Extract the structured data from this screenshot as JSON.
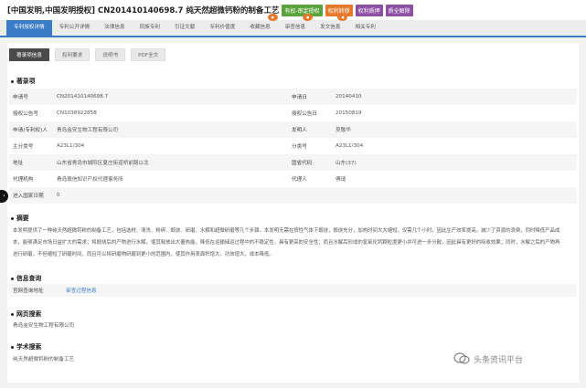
{
  "header": {
    "title": "[中国发明,中国发明授权] CN201410140698.7   纯天然超微钙粉的制备工艺",
    "badges": [
      {
        "label": "有权-审定授权",
        "color": "#5aa33c"
      },
      {
        "label": "权利转移",
        "color": "#e8792c"
      },
      {
        "label": "权利质押",
        "color": "#8d4fa3"
      },
      {
        "label": "质全解除",
        "color": "#8d4fa3"
      }
    ]
  },
  "tabs": [
    {
      "label": "专利授权详情",
      "active": true
    },
    {
      "label": "专利公开详情"
    },
    {
      "label": "法律信息"
    },
    {
      "label": "同族专利"
    },
    {
      "label": "引证文献"
    },
    {
      "label": "专利价值度"
    },
    {
      "label": "收藏信息"
    },
    {
      "label": "审查信息"
    },
    {
      "label": "发文信息"
    },
    {
      "label": "相关专利"
    }
  ],
  "buttons": [
    "著录项信息",
    "权利要求",
    "说明书",
    "PDF全文"
  ],
  "sections": {
    "biblio": "著录项",
    "abstract": "摘要",
    "info_query": "信息查询",
    "web_search": "网页搜索",
    "academic_search": "学术搜索"
  },
  "biblio": {
    "rows": [
      {
        "l1": "申请号",
        "v1": "CN201410140698.7",
        "l2": "申请日",
        "v2": "20140410"
      },
      {
        "l1": "授权公告号",
        "v1": "CN103892285B",
        "l2": "授权公告日",
        "v2": "20150819"
      },
      {
        "l1": "申请(专利权)人",
        "v1": "青岛金安生物工程有限公司",
        "l2": "发明人",
        "v2": "吴敬华"
      },
      {
        "l1": "主分类号",
        "v1": "A23L1/304",
        "l2": "分类号",
        "v2": "A23L1/304"
      },
      {
        "l1": "地址",
        "v1": "山东省青岛市城阳区夏庄街道桥前路以北",
        "l2": "国省代码",
        "v2": "山东(37)"
      },
      {
        "l1": "代理机构",
        "v1": "青岛联信知识产权代理事务所",
        "l2": "代理人",
        "v2": "傅琦"
      },
      {
        "l1": "进入国家日期",
        "v1": "0",
        "l2": "",
        "v2": ""
      }
    ]
  },
  "abstract_text": "本发明提供了一种纯天然超微钙粉的制备工艺，包括选材、清洗、粉碎、煅烧、研磨、水解和超微研磨等几个步骤。本发明无需在惰性气体下煅烧，煅烧充分，加热时间大大缩短，仅需几个小时，因此生产效率提高，减少了资源的浪费，同时降低产品成本，能够满足市场日益扩大的需求；将煅烧后的产物进行水解，使其释放出大量热能，降低在运输储运过程中的不稳定性，具有更高的安全性；而且水解后形成的氢氧化钙颗粒度更小并可进一步分散，因此具有更好的吸收效果；同时，水解之后的产物再进行研磨，不但缩短了研磨时间，而且可以将研磨物研磨到更小的范围内，使其作用表面积增大，功效增大，成本降低。",
  "info_query": {
    "label": "官网查询地址",
    "link": "审查过程信息"
  },
  "web_search_text": "青岛金安生物工程有限公司",
  "academic_search_text": "纯天然超微钙粉的制备工艺",
  "watermark": "头条资讯平台",
  "colors": {
    "accent": "#3a7cc7"
  }
}
